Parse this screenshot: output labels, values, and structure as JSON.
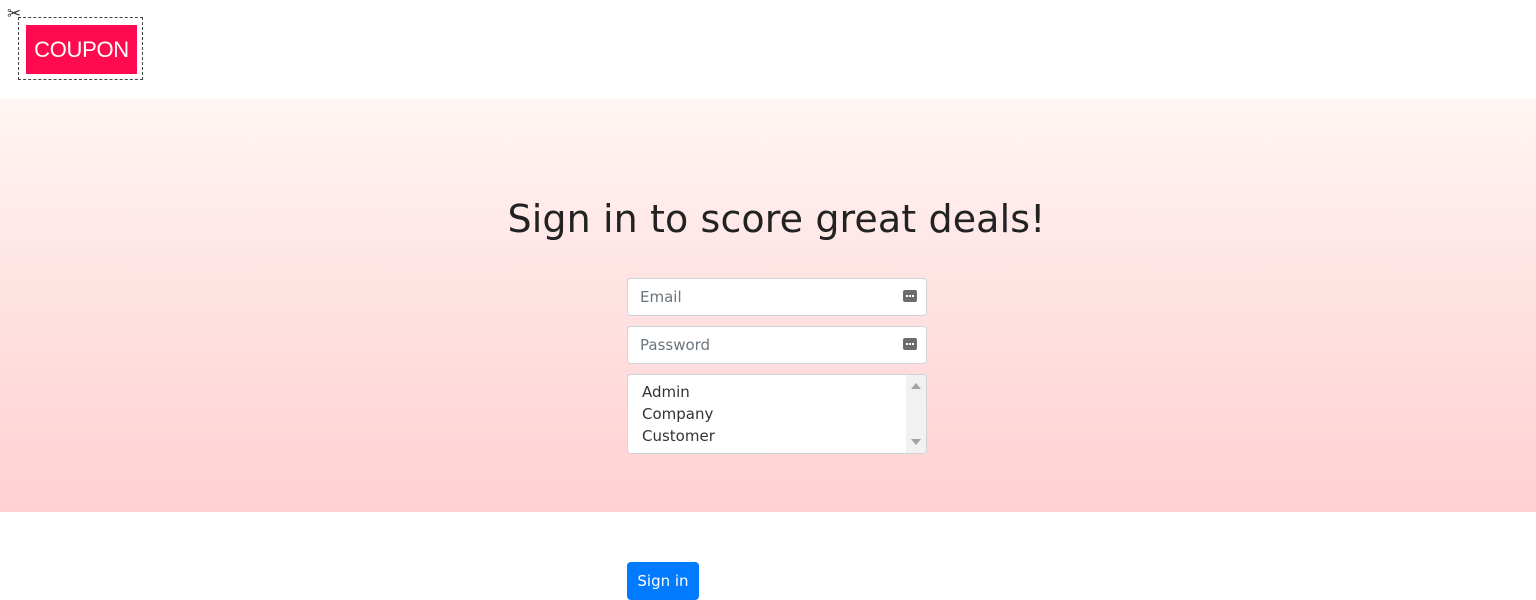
{
  "header": {
    "logo_text": "COUPON",
    "scissors_icon": "scissors-icon"
  },
  "main": {
    "heading": "Sign in to score great deals!"
  },
  "form": {
    "email": {
      "value": "",
      "placeholder": "Email",
      "icon": "autofill-key-icon"
    },
    "password": {
      "value": "",
      "placeholder": "Password",
      "icon": "autofill-key-icon"
    },
    "role_options": [
      "Admin",
      "Company",
      "Customer"
    ],
    "sign_in_label": "Sign in"
  },
  "colors": {
    "logo_background": "#ff0a4f",
    "primary_button": "#007bff",
    "gradient_top": "#fff6f4",
    "gradient_bottom": "#ffd1d2"
  }
}
